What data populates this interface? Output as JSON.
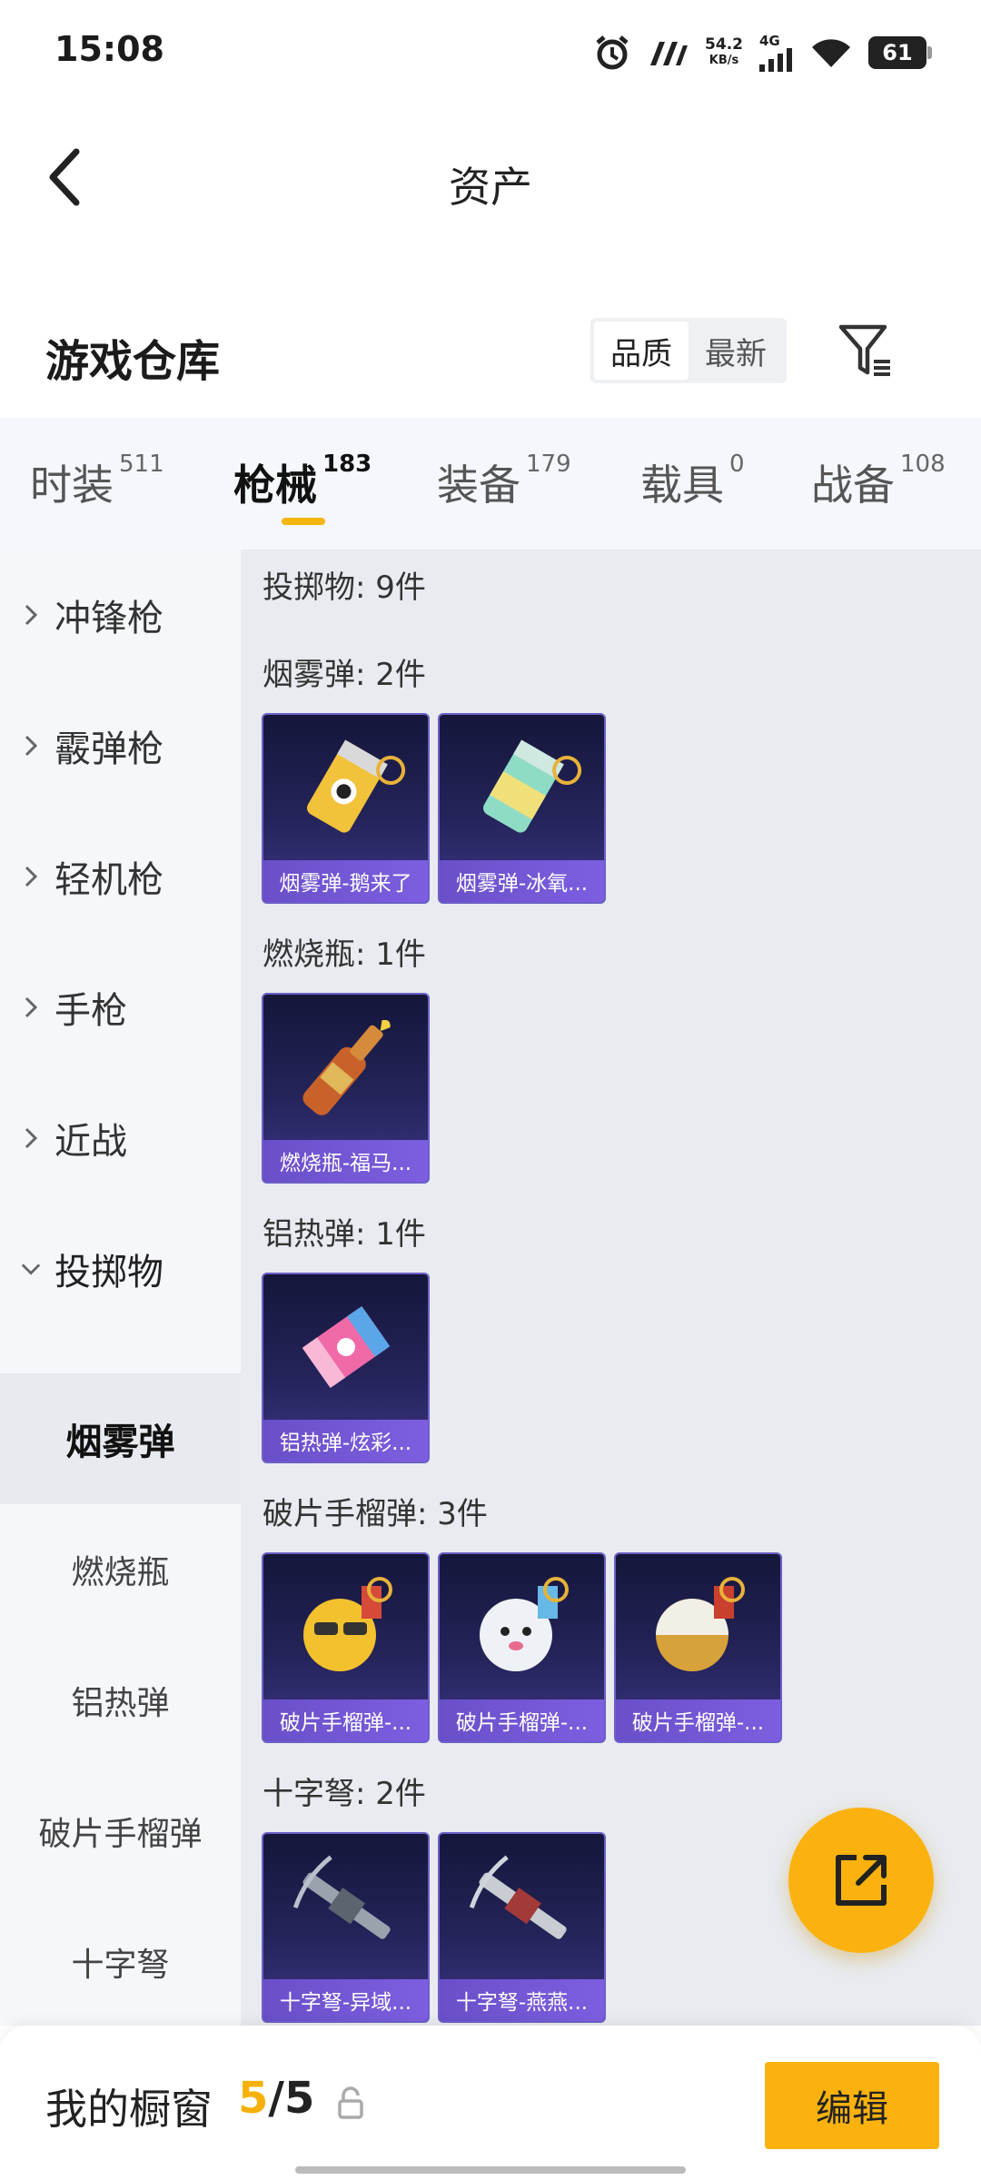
{
  "status_bar": {
    "time": "15:08",
    "speed_value": "54.2",
    "speed_unit": "KB/s",
    "network": "4G",
    "battery": "61",
    "icons": [
      "alarm-icon",
      "app-notification-icon",
      "signal-icon",
      "wifi-icon",
      "battery-icon"
    ]
  },
  "header": {
    "title": "资产",
    "back_icon": "chevron-left-icon"
  },
  "section": {
    "title": "游戏仓库",
    "sort_options": [
      "品质",
      "最新"
    ],
    "active_sort": "品质",
    "filter_icon": "filter-icon"
  },
  "tabs": [
    {
      "label": "时装",
      "count": "511"
    },
    {
      "label": "枪械",
      "count": "183",
      "active": true
    },
    {
      "label": "装备",
      "count": "179"
    },
    {
      "label": "载具",
      "count": "0"
    },
    {
      "label": "战备",
      "count": "108"
    }
  ],
  "sidebar": {
    "categories": [
      "冲锋枪",
      "霰弹枪",
      "轻机枪",
      "手枪",
      "近战",
      "投掷物"
    ],
    "expanded": "投掷物",
    "subcategories": [
      "烟雾弹",
      "燃烧瓶",
      "铝热弹",
      "破片手榴弹",
      "十字弩"
    ],
    "active_sub": "烟雾弹"
  },
  "content": {
    "summary": "投掷物: 9件",
    "groups": [
      {
        "title": "烟雾弹: 2件",
        "items": [
          "烟雾弹-鹅来了",
          "烟雾弹-冰氧..."
        ]
      },
      {
        "title": "燃烧瓶: 1件",
        "items": [
          "燃烧瓶-福马..."
        ]
      },
      {
        "title": "铝热弹: 1件",
        "items": [
          "铝热弹-炫彩..."
        ]
      },
      {
        "title": "破片手榴弹: 3件",
        "items": [
          "破片手榴弹-...",
          "破片手榴弹-...",
          "破片手榴弹-..."
        ]
      },
      {
        "title": "十字弩: 2件",
        "items": [
          "十字弩-异域...",
          "十字弩-燕燕..."
        ]
      }
    ]
  },
  "fab": {
    "icon": "share-external-icon"
  },
  "bottom_bar": {
    "label": "我的橱窗",
    "count_current": "5",
    "count_sep": "/",
    "count_total": "5",
    "lock_icon": "lock-icon",
    "edit_label": "编辑"
  },
  "colors": {
    "accent": "#fbb20e",
    "card_bg": "#24245a",
    "caption_bg": "#7c5fe0"
  }
}
